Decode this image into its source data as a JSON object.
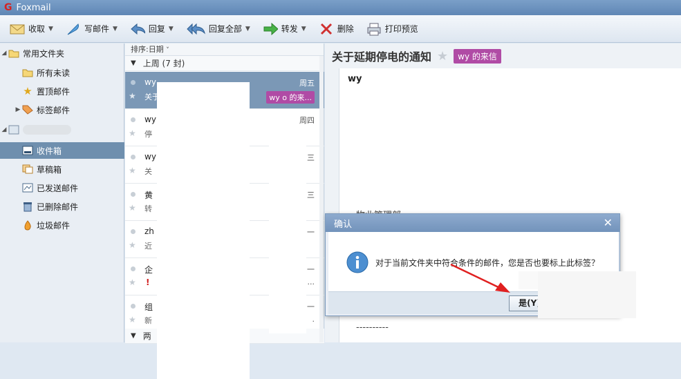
{
  "app": {
    "title": "Foxmail"
  },
  "toolbar": {
    "receive": "收取",
    "compose": "写邮件",
    "reply": "回复",
    "reply_all": "回复全部",
    "forward": "转发",
    "delete": "删除",
    "print_preview": "打印预览"
  },
  "sidebar": {
    "common_folders": "常用文件夹",
    "unread": "所有未读",
    "pinned": "置顶邮件",
    "tagged": "标签邮件",
    "inbox": "收件箱",
    "drafts": "草稿箱",
    "sent": "已发送邮件",
    "deleted": "已删除邮件",
    "junk": "垃圾邮件"
  },
  "list": {
    "sort_label": "排序:日期",
    "group_last_week": "上周 (7 封)",
    "group_next": "两",
    "mails": [
      {
        "sender": "wy",
        "subject": "关于",
        "day": "周五",
        "tag": "wy  o 的来..."
      },
      {
        "sender": "wy",
        "subject": "停",
        "day": "周四"
      },
      {
        "sender": "wy",
        "subject": "关",
        "day": "周三"
      },
      {
        "sender": "黄",
        "subject": "转",
        "day": "三"
      },
      {
        "sender": "zh",
        "subject": "近",
        "day": "一"
      },
      {
        "sender": "企",
        "subject": "!",
        "day": "一",
        "extra": "..."
      },
      {
        "sender": "组",
        "subject": "新",
        "day": "一",
        "extra": "."
      }
    ]
  },
  "reader": {
    "title": "关于延期停电的通知",
    "tag": "wy    的来信",
    "from": "wy",
    "line_property": "物业管理部",
    "line_dashes": "----------"
  },
  "dialog": {
    "title": "确认",
    "message": "对于当前文件夹中符合条件的邮件，您是否也要标上此标签？",
    "yes_button": "是(Y)"
  },
  "colors": {
    "accent": "#6f8fae",
    "tag": "#b04ba5",
    "annotation_arrow": "#e02020"
  }
}
